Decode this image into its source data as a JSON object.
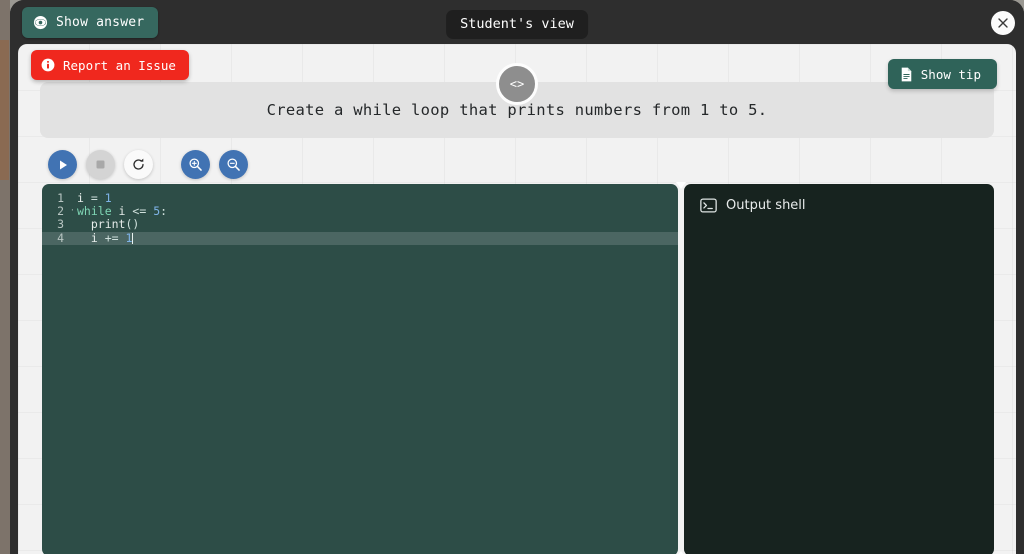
{
  "window": {
    "background_color": "#9a9892",
    "modal_background": "#2e2e2e",
    "inner_background": "#f2f2f2"
  },
  "topbar": {
    "show_answer_label": "Show answer",
    "show_answer_icon": "eye-icon",
    "show_answer_color": "#36685f",
    "student_view_badge": "Student's view",
    "close_icon": "close-icon"
  },
  "header": {
    "report_issue_label": "Report an Issue",
    "report_issue_icon": "info-circle-icon",
    "report_issue_color": "#f0281e",
    "show_tip_label": "Show tip",
    "show_tip_icon": "document-icon",
    "show_tip_color": "#2f6359",
    "code_badge_label": "<>"
  },
  "instruction": {
    "text": "Create a while loop that prints numbers from 1 to 5."
  },
  "toolbar": {
    "buttons": [
      {
        "name": "run-button",
        "icon": "play-icon",
        "style": "blue",
        "title": "Run"
      },
      {
        "name": "stop-button",
        "icon": "stop-icon",
        "style": "gray",
        "title": "Stop"
      },
      {
        "name": "reset-button",
        "icon": "refresh-icon",
        "style": "white",
        "title": "Reset"
      },
      {
        "name": "zoom-in-button",
        "icon": "zoom-in-icon",
        "style": "blue",
        "title": "Zoom in"
      },
      {
        "name": "zoom-out-button",
        "icon": "zoom-out-icon",
        "style": "blue",
        "title": "Zoom out"
      }
    ]
  },
  "editor": {
    "background_color": "#2d4d47",
    "active_line": 4,
    "lines": [
      {
        "number": "1",
        "fold": "",
        "indent": "",
        "tokens": [
          {
            "t": "i ",
            "c": "fn"
          },
          {
            "t": "= ",
            "c": "op"
          },
          {
            "t": "1",
            "c": "num"
          }
        ]
      },
      {
        "number": "2",
        "fold": "·",
        "indent": "",
        "tokens": [
          {
            "t": "while ",
            "c": "kw"
          },
          {
            "t": "i ",
            "c": "fn"
          },
          {
            "t": "<= ",
            "c": "op"
          },
          {
            "t": "5",
            "c": "num"
          },
          {
            "t": ":",
            "c": "op"
          }
        ]
      },
      {
        "number": "3",
        "fold": "",
        "indent": "  ",
        "tokens": [
          {
            "t": "print",
            "c": "fn"
          },
          {
            "t": "()",
            "c": "op"
          }
        ]
      },
      {
        "number": "4",
        "fold": "",
        "indent": "  ",
        "tokens": [
          {
            "t": "i ",
            "c": "fn"
          },
          {
            "t": "+= ",
            "c": "op"
          },
          {
            "t": "1",
            "c": "num"
          }
        ]
      }
    ]
  },
  "output": {
    "title": "Output shell",
    "icon": "terminal-icon",
    "background_color": "#17231f",
    "content": ""
  }
}
